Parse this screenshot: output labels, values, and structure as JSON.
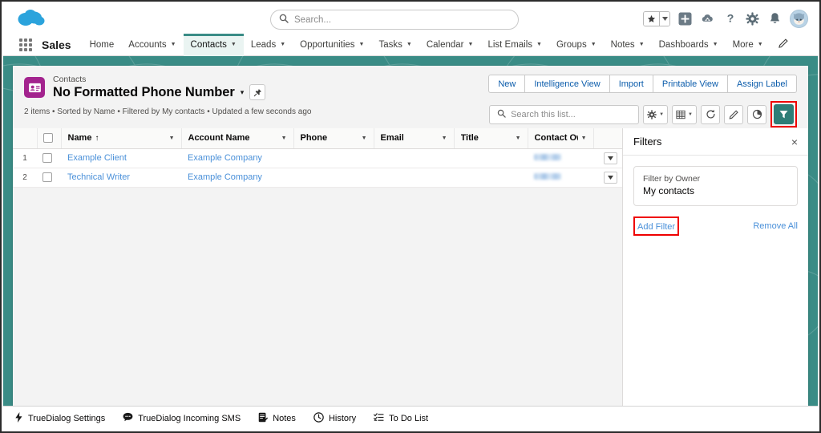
{
  "global_header": {
    "logo_name": "salesforce-cloud-logo",
    "search_placeholder": "Search...",
    "search_value": "",
    "icons": [
      {
        "name": "favorites-star-icon",
        "glyph": "★"
      },
      {
        "name": "favorites-caret-icon",
        "glyph": "▾"
      },
      {
        "name": "add-plus-icon",
        "glyph": "+"
      },
      {
        "name": "cloud-setup-icon",
        "glyph": "☁"
      },
      {
        "name": "help-question-icon",
        "glyph": "?"
      },
      {
        "name": "settings-gear-icon",
        "glyph": "⚙"
      },
      {
        "name": "notifications-bell-icon",
        "glyph": "ὑ4"
      },
      {
        "name": "user-avatar",
        "glyph": ""
      }
    ]
  },
  "nav": {
    "app_name": "Sales",
    "items": [
      {
        "label": "Home",
        "caret": false,
        "active": false
      },
      {
        "label": "Accounts",
        "caret": true,
        "active": false
      },
      {
        "label": "Contacts",
        "caret": true,
        "active": true
      },
      {
        "label": "Leads",
        "caret": true,
        "active": false
      },
      {
        "label": "Opportunities",
        "caret": true,
        "active": false
      },
      {
        "label": "Tasks",
        "caret": true,
        "active": false
      },
      {
        "label": "Calendar",
        "caret": true,
        "active": false
      },
      {
        "label": "List Emails",
        "caret": true,
        "active": false
      },
      {
        "label": "Groups",
        "caret": true,
        "active": false
      },
      {
        "label": "Notes",
        "caret": true,
        "active": false
      },
      {
        "label": "Dashboards",
        "caret": true,
        "active": false
      },
      {
        "label": "More",
        "caret": true,
        "active": false
      }
    ],
    "edit_pencil_name": "edit-nav-pencil-icon"
  },
  "list_header": {
    "object_label": "Contacts",
    "view_title": "No Formatted Phone Number",
    "title_caret": "▾",
    "pin_icon": "pin-icon",
    "meta": "2 items • Sorted by Name • Filtered by My contacts • Updated a few seconds ago"
  },
  "actions": [
    {
      "label": "New"
    },
    {
      "label": "Intelligence View"
    },
    {
      "label": "Import"
    },
    {
      "label": "Printable View"
    },
    {
      "label": "Assign Label"
    }
  ],
  "tools": {
    "search_placeholder": "Search this list...",
    "search_value": "",
    "buttons": [
      {
        "name": "list-view-controls-gear-button",
        "glyph": "⚙",
        "caret": true
      },
      {
        "name": "display-as-table-button",
        "glyph": "▦",
        "caret": true
      },
      {
        "name": "refresh-button",
        "glyph": "⟳",
        "caret": false
      },
      {
        "name": "edit-pencil-button",
        "glyph": "✎",
        "caret": false
      },
      {
        "name": "charts-button",
        "glyph": "◔",
        "caret": false
      }
    ],
    "filter_button": {
      "name": "filter-funnel-button",
      "highlighted": true,
      "color": "#2e7d77"
    }
  },
  "table": {
    "columns": [
      {
        "label": "Name",
        "sorted": true,
        "sort_glyph": "↑"
      },
      {
        "label": "Account Name",
        "sorted": false
      },
      {
        "label": "Phone",
        "sorted": false
      },
      {
        "label": "Email",
        "sorted": false
      },
      {
        "label": "Title",
        "sorted": false
      },
      {
        "label": "Contact Ow...",
        "sorted": false
      }
    ],
    "rows": [
      {
        "num": "1",
        "name": "Example Client",
        "account": "Example Company",
        "phone": "",
        "email": "",
        "title": "",
        "owner_redacted": true
      },
      {
        "num": "2",
        "name": "Technical Writer",
        "account": "Example Company",
        "phone": "",
        "email": "",
        "title": "",
        "owner_redacted": true
      }
    ]
  },
  "filters_panel": {
    "title": "Filters",
    "close_glyph": "×",
    "filter_card": {
      "label": "Filter by Owner",
      "value": "My contacts"
    },
    "add_filter_label": "Add Filter",
    "add_filter_highlighted": true,
    "remove_all_label": "Remove All"
  },
  "utility_bar": [
    {
      "label": "TrueDialog Settings",
      "icon": "lightning-bolt-icon"
    },
    {
      "label": "TrueDialog Incoming SMS",
      "icon": "chat-bubble-icon"
    },
    {
      "label": "Notes",
      "icon": "notes-icon"
    },
    {
      "label": "History",
      "icon": "clock-icon"
    },
    {
      "label": "To Do List",
      "icon": "checklist-icon"
    }
  ],
  "colors": {
    "brand_teal": "#3a8c86",
    "filter_teal": "#2e7d77",
    "highlight_red": "#ef0000",
    "link_blue": "#4a90d9",
    "object_purple": "#a3238e"
  }
}
